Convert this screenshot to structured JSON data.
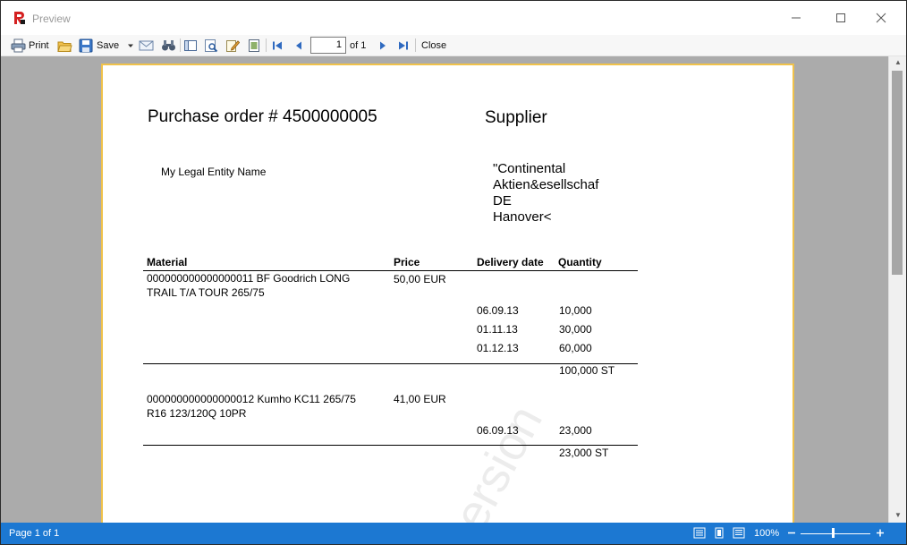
{
  "window": {
    "title": "Preview"
  },
  "toolbar": {
    "print_label": "Print",
    "save_label": "Save",
    "page_value": "1",
    "page_of": "of 1",
    "close_label": "Close"
  },
  "report": {
    "title": "Purchase order # 4500000005",
    "supplier_heading": "Supplier",
    "legal_entity": "My Legal Entity Name",
    "supplier_address": [
      "\"Continental",
      "Aktien&esellschaf",
      "DE",
      "Hanover<"
    ],
    "headers": {
      "material": "Material",
      "price": "Price",
      "delivery": "Delivery date",
      "quantity": "Quantity"
    },
    "items": [
      {
        "material_line1": "000000000000000011 BF Goodrich LONG",
        "material_line2": "TRAIL T/A TOUR 265/75",
        "price": "50,00 EUR",
        "deliveries": [
          {
            "date": "06.09.13",
            "qty": "10,000"
          },
          {
            "date": "01.11.13",
            "qty": "30,000"
          },
          {
            "date": "01.12.13",
            "qty": "60,000"
          }
        ],
        "total": "100,000 ST"
      },
      {
        "material_line1": "000000000000000012 Kumho KC11 265/75",
        "material_line2": "R16 123/120Q 10PR",
        "price": "41,00 EUR",
        "deliveries": [
          {
            "date": "06.09.13",
            "qty": "23,000"
          }
        ],
        "total": "23,000 ST"
      }
    ],
    "watermark": "ersion"
  },
  "status": {
    "page_text": "Page 1 of 1",
    "zoom": "100%"
  },
  "colors": {
    "status_bar": "#1c78d2",
    "page_border": "#f0c24a",
    "preview_bg": "#ababab"
  }
}
